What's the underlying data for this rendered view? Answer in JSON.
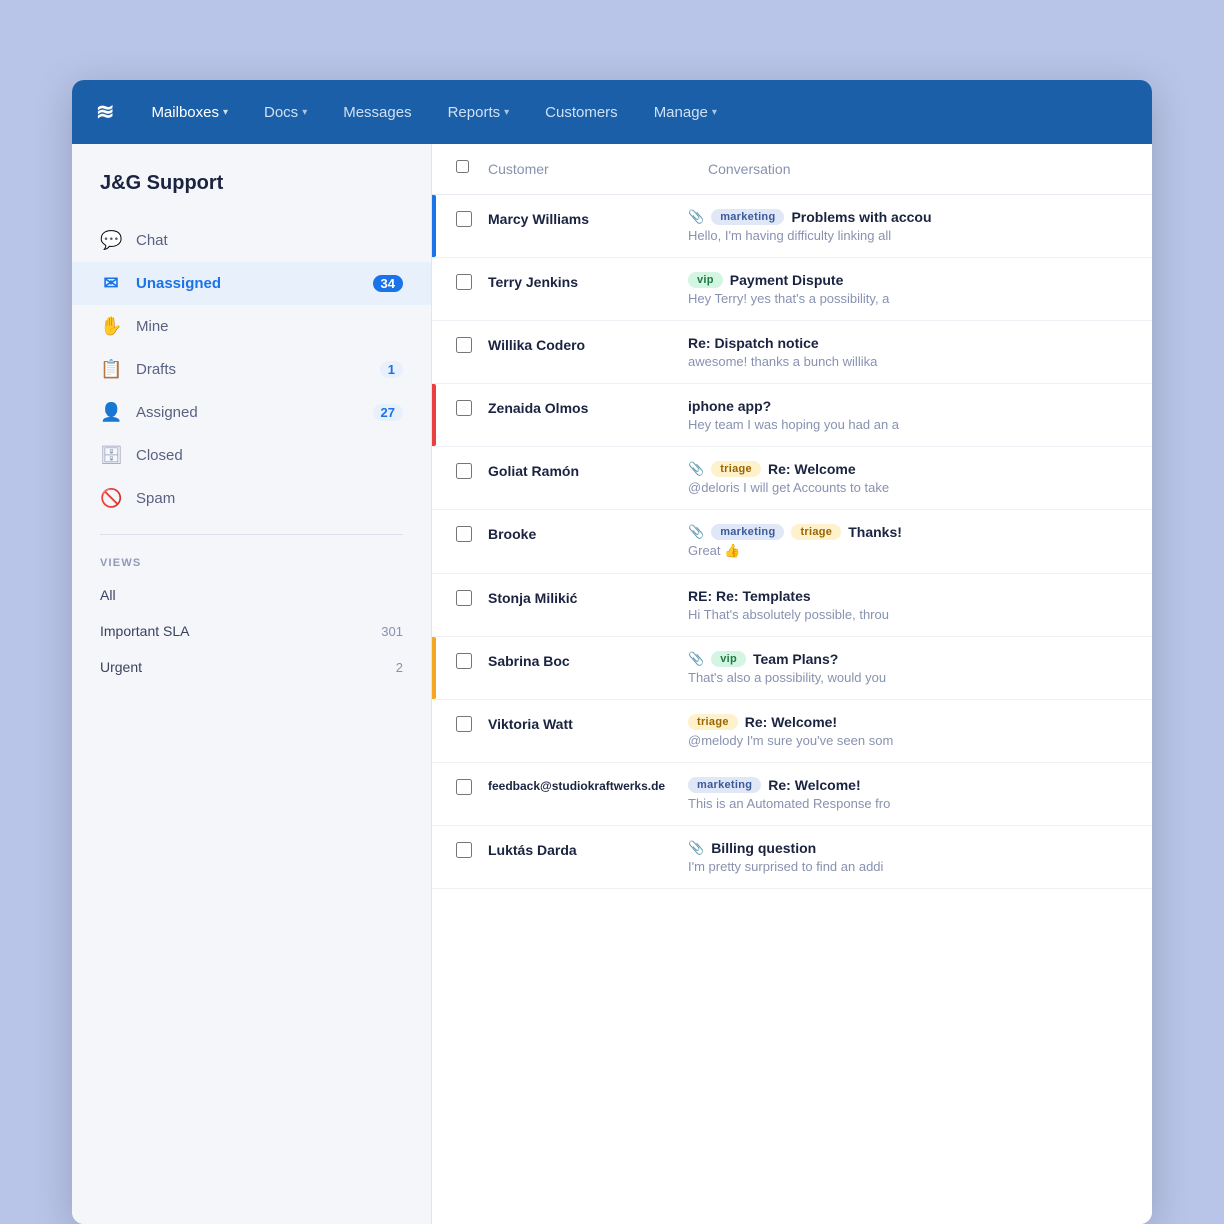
{
  "nav": {
    "logo": "≋",
    "items": [
      {
        "label": "Mailboxes",
        "has_chevron": true
      },
      {
        "label": "Docs",
        "has_chevron": true
      },
      {
        "label": "Messages",
        "has_chevron": false
      },
      {
        "label": "Reports",
        "has_chevron": true
      },
      {
        "label": "Customers",
        "has_chevron": false
      },
      {
        "label": "Manage",
        "has_chevron": true
      }
    ]
  },
  "sidebar": {
    "title": "J&G Support",
    "nav_items": [
      {
        "id": "chat",
        "label": "Chat",
        "icon": "💬",
        "badge": null,
        "active": false
      },
      {
        "id": "unassigned",
        "label": "Unassigned",
        "icon": "✉",
        "badge": "34",
        "active": true
      },
      {
        "id": "mine",
        "label": "Mine",
        "icon": "✋",
        "badge": null,
        "active": false
      },
      {
        "id": "drafts",
        "label": "Drafts",
        "icon": "📋",
        "badge": "1",
        "active": false
      },
      {
        "id": "assigned",
        "label": "Assigned",
        "icon": "👤",
        "badge": "27",
        "active": false
      },
      {
        "id": "closed",
        "label": "Closed",
        "icon": "🗄",
        "badge": null,
        "active": false
      },
      {
        "id": "spam",
        "label": "Spam",
        "icon": "🚫",
        "badge": null,
        "active": false
      }
    ],
    "views_label": "VIEWS",
    "views": [
      {
        "label": "All",
        "badge": null
      },
      {
        "label": "Important SLA",
        "badge": "301"
      },
      {
        "label": "Urgent",
        "badge": "2"
      }
    ]
  },
  "conv_list": {
    "header": {
      "customer_label": "Customer",
      "conversation_label": "Conversation"
    },
    "rows": [
      {
        "customer": "Marcy Williams",
        "has_attachment": true,
        "tags": [
          {
            "label": "marketing",
            "type": "marketing"
          }
        ],
        "subject": "Problems with accou",
        "preview": "Hello, I'm having difficulty linking all",
        "flag": "blue"
      },
      {
        "customer": "Terry Jenkins",
        "has_attachment": false,
        "tags": [
          {
            "label": "vip",
            "type": "vip"
          }
        ],
        "subject": "Payment Dispute",
        "preview": "Hey Terry! yes that's a possibility, a",
        "flag": null
      },
      {
        "customer": "Willika Codero",
        "has_attachment": false,
        "tags": [],
        "subject": "Re: Dispatch notice",
        "preview": "awesome! thanks a bunch willika",
        "flag": null
      },
      {
        "customer": "Zenaida Olmos",
        "has_attachment": false,
        "tags": [],
        "subject": "iphone app?",
        "preview": "Hey team I was hoping you had an a",
        "flag": "red"
      },
      {
        "customer": "Goliat Ramón",
        "has_attachment": true,
        "tags": [
          {
            "label": "triage",
            "type": "triage"
          }
        ],
        "subject": "Re: Welcome",
        "preview": "@deloris I will get Accounts to take",
        "flag": null
      },
      {
        "customer": "Brooke",
        "has_attachment": true,
        "tags": [
          {
            "label": "marketing",
            "type": "marketing"
          },
          {
            "label": "triage",
            "type": "triage"
          }
        ],
        "subject": "Thanks!",
        "preview": "Great 👍",
        "flag": null
      },
      {
        "customer": "Stonja Milikić",
        "has_attachment": false,
        "tags": [],
        "subject": "RE: Re: Templates",
        "preview": "Hi That's absolutely possible, throu",
        "flag": null
      },
      {
        "customer": "Sabrina Boc",
        "has_attachment": true,
        "tags": [
          {
            "label": "vip",
            "type": "vip"
          }
        ],
        "subject": "Team Plans?",
        "preview": "That's also a possibility, would you",
        "flag": "orange"
      },
      {
        "customer": "Viktoria Watt",
        "has_attachment": false,
        "tags": [
          {
            "label": "triage",
            "type": "triage"
          }
        ],
        "subject": "Re: Welcome!",
        "preview": "@melody I'm sure you've seen som",
        "flag": null
      },
      {
        "customer": "feedback@studiokraftwerks.de",
        "has_attachment": false,
        "tags": [
          {
            "label": "marketing",
            "type": "marketing"
          }
        ],
        "subject": "Re: Welcome!",
        "preview": "This is an Automated Response fro",
        "flag": null
      },
      {
        "customer": "Luktás Darda",
        "has_attachment": true,
        "tags": [],
        "subject": "Billing question",
        "preview": "I'm pretty surprised to find an addi",
        "flag": null
      }
    ]
  }
}
